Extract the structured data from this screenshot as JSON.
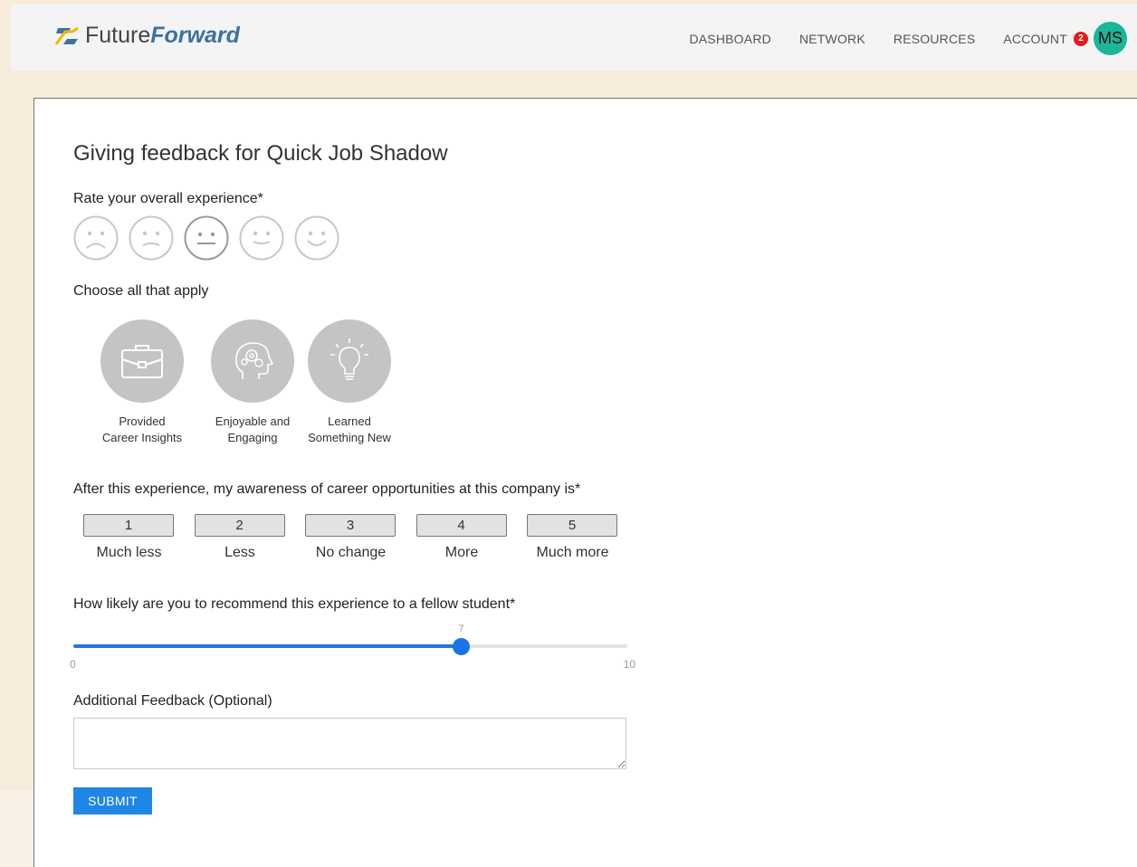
{
  "header": {
    "brand_part1": "Future",
    "brand_part2": "Forward",
    "nav": [
      "DASHBOARD",
      "NETWORK",
      "RESOURCES",
      "ACCOUNT"
    ],
    "notification_count": "2",
    "avatar_initials": "MS",
    "accent_color": "#19b69a"
  },
  "form": {
    "title": "Giving feedback for Quick Job Shadow",
    "rating_label": "Rate your overall experience*",
    "rating_faces": [
      "very-sad-face-icon",
      "sad-face-icon",
      "neutral-face-icon",
      "smile-face-icon",
      "happy-face-icon"
    ],
    "choose_label": "Choose all that apply",
    "options": [
      {
        "line1": "Provided",
        "line2": "Career Insights",
        "icon": "briefcase-icon"
      },
      {
        "line1": "Enjoyable and",
        "line2": "Engaging",
        "icon": "head-gears-icon"
      },
      {
        "line1": "Learned",
        "line2": "Something New",
        "icon": "lightbulb-icon"
      }
    ],
    "awareness_label": "After this experience, my awareness of career opportunities at this company is*",
    "awareness_scale": [
      {
        "value": "1",
        "caption": "Much less"
      },
      {
        "value": "2",
        "caption": "Less"
      },
      {
        "value": "3",
        "caption": "No change"
      },
      {
        "value": "4",
        "caption": "More"
      },
      {
        "value": "5",
        "caption": "Much more"
      }
    ],
    "recommend_label": "How likely are you to recommend this experience to a fellow student*",
    "slider": {
      "min": "0",
      "max": "10",
      "value": "7"
    },
    "additional_label": "Additional Feedback (Optional)",
    "additional_value": "",
    "submit_label": "SUBMIT"
  }
}
